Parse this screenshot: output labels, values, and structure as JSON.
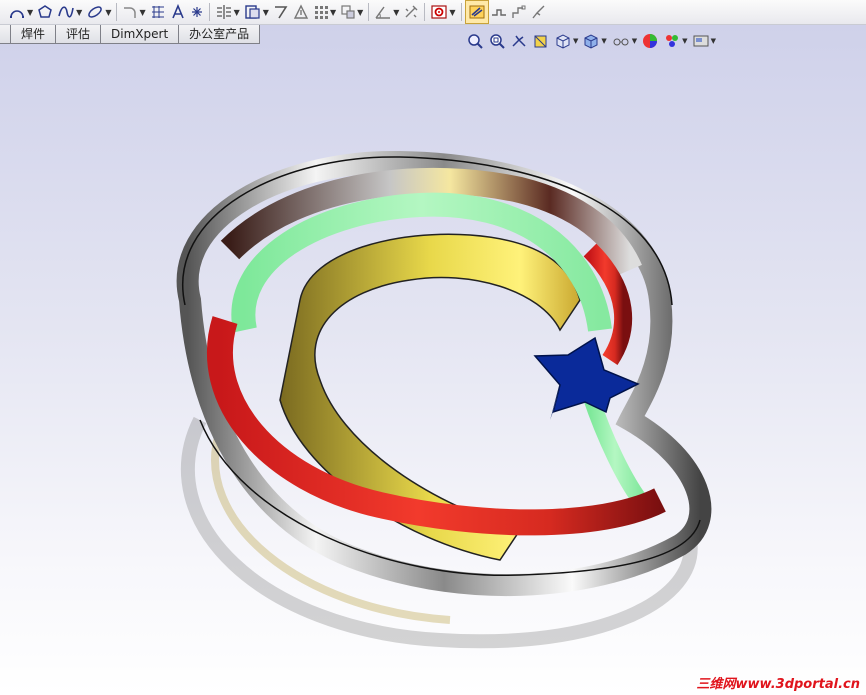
{
  "tabs": [
    {
      "label": ""
    },
    {
      "label": "焊件"
    },
    {
      "label": "评估"
    },
    {
      "label": "DimXpert"
    },
    {
      "label": "办公室产品"
    }
  ],
  "toolbar_icons": [
    "smart-dimension-icon",
    "polygon-icon",
    "spline-icon",
    "ellipse-icon",
    "fillet-icon",
    "text-icon",
    "point-icon",
    "mirror-icon",
    "offset-icon",
    "convert-icon",
    "trim-icon",
    "pattern-icon",
    "move-icon",
    "relation-icon",
    "repair-icon",
    "sketch-icon",
    "rapid-sketch-icon"
  ],
  "headsup_icons": [
    "zoom-to-fit-icon",
    "zoom-area-icon",
    "previous-view-icon",
    "section-view-icon",
    "view-orientation-icon",
    "display-style-icon",
    "hide-show-icon",
    "edit-appearance-icon",
    "apply-scene-icon",
    "view-settings-icon"
  ],
  "watermark": "三维网www.3dportal.cn",
  "colors": {
    "red_band": "#e0201c",
    "green_band": "#8ff2a2",
    "gold_band": "#f0e040",
    "star": "#0a2a9a",
    "bg_top": "#cfd1ea",
    "bg_bottom": "#ffffff"
  }
}
